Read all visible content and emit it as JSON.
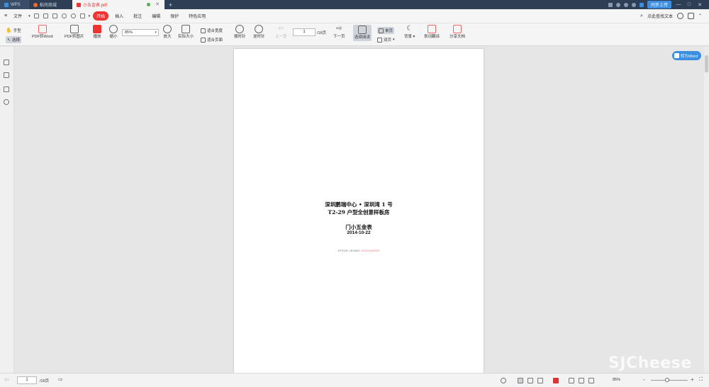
{
  "titlebar": {
    "tabs": [
      {
        "label": "WPS"
      },
      {
        "label": "稻壳商城"
      },
      {
        "label": "小五金表.pdf"
      }
    ],
    "login_label": "同步上传"
  },
  "menubar": {
    "file": "文件",
    "items": [
      "开始",
      "插入",
      "批注",
      "编辑",
      "保护",
      "特色应用"
    ],
    "search": "点此查找文本"
  },
  "toolbar": {
    "hand": "手型",
    "select": "选择",
    "pdf_to_word": "PDF转Word",
    "pdf_to_image": "PDF转图片",
    "play": "播放",
    "zoom_out": "缩小",
    "zoom_value": "85%",
    "zoom_in": "放大",
    "actual_size": "实际大小",
    "fit_width": "适合宽度",
    "fit_page": "适合页面",
    "rotate_cw": "顺时针",
    "rotate_ccw": "逆时针",
    "prev_page": "上一页",
    "page_current": "1",
    "page_total": "/16页",
    "next_page": "下一页",
    "continuous": "连续阅读",
    "single": "单页",
    "double": "双页",
    "background": "背景",
    "translate": "划词翻译",
    "share": "分享文档"
  },
  "sidebar": {
    "icons": [
      "bookmark-icon",
      "thumbnail-icon",
      "annotation-icon",
      "attachment-icon"
    ]
  },
  "document": {
    "line1": "深圳鹏瑞中心 • 深圳湾 1 号",
    "line2": "T2-29 户型全创意样板房",
    "line3": "门小五金表",
    "line4": "2014-10-22",
    "brand_a": "STEVE LEUNG ",
    "brand_b": "DESIGNERS"
  },
  "to_word_button": "转为Word",
  "watermark": "SJCheese",
  "statusbar": {
    "page_current": "1",
    "page_total": "/16页",
    "zoom": "85%",
    "minus": "-",
    "plus": "+"
  },
  "colors": {
    "titlebar": "#2d3e55",
    "accent": "#e33333",
    "blue": "#3b8ee0"
  }
}
